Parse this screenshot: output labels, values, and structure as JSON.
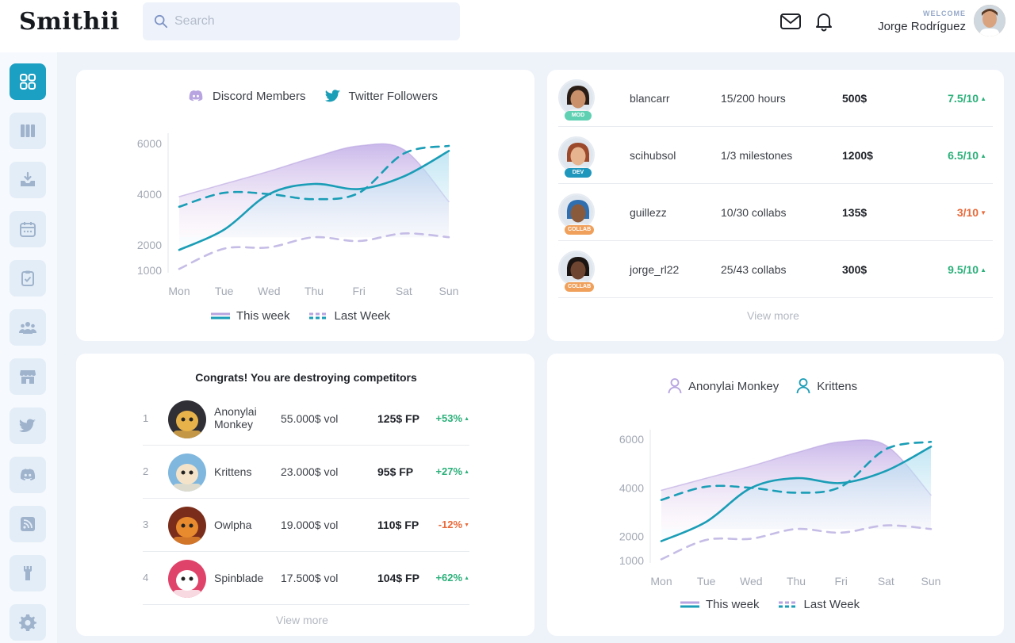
{
  "header": {
    "logo": "Smithii",
    "search_placeholder": "Search",
    "welcome_label": "WELCOME",
    "user_name": "Jorge Rodríguez"
  },
  "sidebar": {
    "items": [
      {
        "icon": "grid-icon",
        "active": true
      },
      {
        "icon": "columns-icon"
      },
      {
        "icon": "download-icon"
      },
      {
        "icon": "calendar-icon"
      },
      {
        "icon": "clipboard-icon"
      },
      {
        "icon": "users-icon"
      },
      {
        "icon": "store-icon"
      },
      {
        "icon": "twitter-icon"
      },
      {
        "icon": "discord-icon"
      },
      {
        "icon": "rss-icon"
      },
      {
        "icon": "wrench-icon"
      },
      {
        "icon": "settings-icon"
      }
    ]
  },
  "chart1": {
    "legend_top": [
      "Discord Members",
      "Twitter Followers"
    ],
    "legend_bottom": [
      "This week",
      "Last Week"
    ]
  },
  "chart2": {
    "legend_top": [
      "Anonylai Monkey",
      "Krittens"
    ],
    "legend_bottom": [
      "This week",
      "Last Week"
    ]
  },
  "chart_data": [
    {
      "type": "line",
      "x": [
        "Mon",
        "Tue",
        "Wed",
        "Thu",
        "Fri",
        "Sat",
        "Sun"
      ],
      "yticks": [
        1000,
        2000,
        4000,
        6000
      ],
      "series": [
        {
          "name": "Discord Members",
          "values": [
            3900,
            4400,
            4900,
            5450,
            5900,
            5750,
            3700
          ],
          "style": "solid-area",
          "color": "#b7a4e0"
        },
        {
          "name": "Twitter Followers",
          "values": [
            1800,
            2600,
            4000,
            4400,
            4200,
            4700,
            5700
          ],
          "style": "solid",
          "color": "#1a9db6"
        },
        {
          "name": "Last Week",
          "values": [
            3500,
            4050,
            4000,
            3800,
            4050,
            5600,
            5900
          ],
          "style": "dashed",
          "color": "#1a9db6"
        },
        {
          "name": "Last Week",
          "values": [
            1050,
            1850,
            1900,
            2300,
            2150,
            2450,
            2300
          ],
          "style": "dashed",
          "color": "#c6bde6"
        }
      ]
    },
    {
      "type": "line",
      "x": [
        "Mon",
        "Tue",
        "Wed",
        "Thu",
        "Fri",
        "Sat",
        "Sun"
      ],
      "yticks": [
        1000,
        2000,
        4000,
        6000
      ],
      "series": [
        {
          "name": "Anonylai Monkey",
          "values": [
            3900,
            4400,
            4900,
            5450,
            5900,
            5750,
            3700
          ],
          "style": "solid-area",
          "color": "#b7a4e0"
        },
        {
          "name": "Krittens",
          "values": [
            1800,
            2600,
            4000,
            4400,
            4200,
            4700,
            5700
          ],
          "style": "solid",
          "color": "#1a9db6"
        },
        {
          "name": "Last Week",
          "values": [
            3500,
            4050,
            4000,
            3800,
            4050,
            5600,
            5900
          ],
          "style": "dashed",
          "color": "#1a9db6"
        },
        {
          "name": "Last Week",
          "values": [
            1050,
            1850,
            1900,
            2300,
            2150,
            2450,
            2300
          ],
          "style": "dashed",
          "color": "#c6bde6"
        }
      ]
    }
  ],
  "users": [
    {
      "name": "blancarr",
      "progress": "15/200 hours",
      "amount": "500$",
      "score": "7.5/10",
      "trend": "up",
      "role": "MOD",
      "role_color": "#5fd0b2",
      "skin": "#c9906a",
      "hair": "#2a1d16"
    },
    {
      "name": "scihubsol",
      "progress": "1/3 milestones",
      "amount": "1200$",
      "score": "6.5/10",
      "trend": "up",
      "role": "DEV",
      "role_color": "#1f97bd",
      "skin": "#e6b48e",
      "hair": "#9c4a2b"
    },
    {
      "name": "guillezz",
      "progress": "10/30 collabs",
      "amount": "135$",
      "score": "3/10",
      "trend": "down",
      "role": "COLLAB",
      "role_color": "#f0a05a",
      "skin": "#8a5a3c",
      "hair": "#2f6fb0"
    },
    {
      "name": "jorge_rl22",
      "progress": "25/43 collabs",
      "amount": "300$",
      "score": "9.5/10",
      "trend": "up",
      "role": "COLLAB",
      "role_color": "#f0a05a",
      "skin": "#6e4530",
      "hair": "#1a1412"
    }
  ],
  "users_view_more": "View more",
  "competitors": {
    "title": "Congrats! You are destroying competitors",
    "rows": [
      {
        "rank": "1",
        "name": "Anonylai Monkey",
        "volume": "55.000$ vol",
        "fp": "125$ FP",
        "change": "+53%",
        "trend": "up",
        "color": "#e8b24a",
        "bg": "#2f2f35"
      },
      {
        "rank": "2",
        "name": "Krittens",
        "volume": "23.000$ vol",
        "fp": "95$ FP",
        "change": "+27%",
        "trend": "up",
        "color": "#f4e3c9",
        "bg": "#7fb7de"
      },
      {
        "rank": "3",
        "name": "Owlpha",
        "volume": "19.000$ vol",
        "fp": "110$ FP",
        "change": "-12%",
        "trend": "down",
        "color": "#e88a2e",
        "bg": "#7a2d1a"
      },
      {
        "rank": "4",
        "name": "Spinblade",
        "volume": "17.500$ vol",
        "fp": "104$ FP",
        "change": "+62%",
        "trend": "up",
        "color": "#ffffff",
        "bg": "#e0436a"
      }
    ],
    "view_more": "View more"
  },
  "colors": {
    "accent": "#1b9fc2",
    "positive": "#2bb07a",
    "negative": "#e96a3a",
    "lavender": "#b7a4e0"
  }
}
